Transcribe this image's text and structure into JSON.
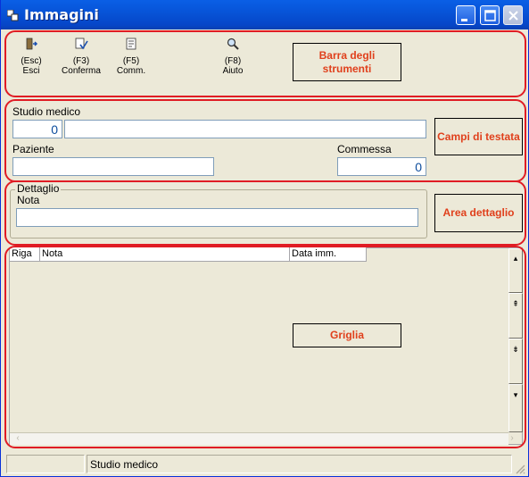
{
  "window": {
    "title": "Immagini",
    "title_icon": "window-icon"
  },
  "toolbar": {
    "buttons": [
      {
        "key": "(Esc)",
        "label": "Esci",
        "icon": "exit-door-icon"
      },
      {
        "key": "(F3)",
        "label": "Conferma",
        "icon": "confirm-check-icon"
      },
      {
        "key": "(F5)",
        "label": "Comm.",
        "icon": "notepad-icon"
      },
      {
        "key": "(F8)",
        "label": "Aiuto",
        "icon": "magnifier-icon"
      }
    ]
  },
  "callouts": {
    "toolbar": "Barra degli strumenti",
    "header": "Campi di testata",
    "detail": "Area dettaglio",
    "grid": "Griglia"
  },
  "header": {
    "studio_label": "Studio medico",
    "studio_code": "0",
    "studio_name": "",
    "paziente_label": "Paziente",
    "paziente_value": "",
    "commessa_label": "Commessa",
    "commessa_value": "0"
  },
  "detail": {
    "legend": "Dettaglio",
    "nota_label": "Nota",
    "nota_value": ""
  },
  "grid": {
    "columns": [
      "Riga",
      "Nota",
      "Data imm."
    ],
    "rows": []
  },
  "statusbar": {
    "panel1": "",
    "panel2": "Studio medico"
  },
  "colors": {
    "accent_red": "#e01c24",
    "callout_text": "#e0401c",
    "titlebar_blue": "#0754d8",
    "window_bg": "#ece9d8"
  }
}
